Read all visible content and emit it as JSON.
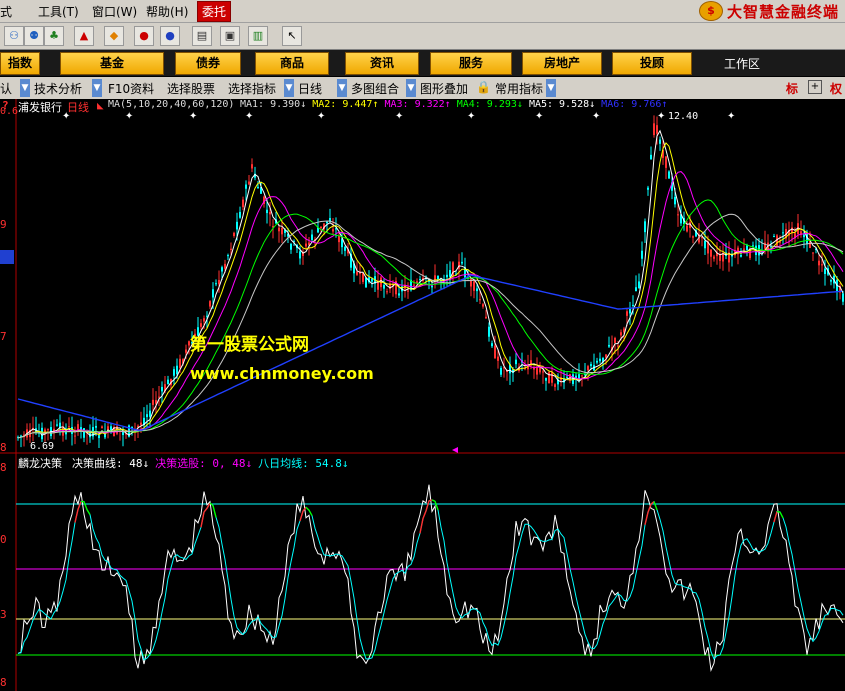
{
  "menu": {
    "items": [
      "式",
      "工具(T)",
      "窗口(W)",
      "帮助(H)",
      "委托"
    ],
    "brand": "大智慧金融终端"
  },
  "nav": {
    "buttons": [
      "指数",
      "基金",
      "债券",
      "商品",
      "资讯",
      "服务",
      "房地产",
      "投顾"
    ],
    "workspace": "工作区"
  },
  "subtoolbar": {
    "items": [
      "认",
      "技术分析",
      "F10资料",
      "选择股票",
      "选择指标",
      "日线",
      "多图组合",
      "图形叠加",
      "常用指标"
    ],
    "right": [
      "标",
      "权"
    ]
  },
  "price_panel": {
    "stock": "浦发银行",
    "period": "日线",
    "ma_params": "MA(5,10,20,40,60,120)",
    "ma": [
      {
        "label": "MA1:",
        "value": "9.390",
        "arrow": "↓",
        "color": "#ffffff"
      },
      {
        "label": "MA2:",
        "value": "9.447",
        "arrow": "↑",
        "color": "#ffff00"
      },
      {
        "label": "MA3:",
        "value": "9.322",
        "arrow": "↑",
        "color": "#ff00ff"
      },
      {
        "label": "MA4:",
        "value": "9.293",
        "arrow": "↓",
        "color": "#00ff00"
      },
      {
        "label": "MA5:",
        "value": "9.528",
        "arrow": "↓",
        "color": "#ffffff"
      },
      {
        "label": "MA6:",
        "value": "9.766",
        "arrow": "↑",
        "color": "#3030ff"
      }
    ],
    "y_ticks": [
      "0.6",
      "9",
      "7",
      "8"
    ],
    "high_label": "12.40",
    "low_label": "6.69",
    "watermark_title": "第一股票公式网",
    "watermark_url": "www.chnmoney.com"
  },
  "indicator_panel": {
    "name": "麟龙决策",
    "items": [
      {
        "label": "决策曲线:",
        "value": "48",
        "arrow": "↓",
        "color": "#ffffff"
      },
      {
        "label": "决策选股:",
        "value": "0, 48",
        "arrow": "↓",
        "color": "#ff00ff"
      },
      {
        "label": "八日均线:",
        "value": "54.8",
        "arrow": "↓",
        "color": "#00ffff"
      }
    ],
    "y_ticks": [
      "8",
      "0",
      "3",
      "8"
    ]
  },
  "colors": {
    "up": "#ff3030",
    "down": "#00ffff",
    "ma1": "#ffffff",
    "ma2": "#ffff00",
    "ma3": "#ff00ff",
    "ma4": "#00ff00",
    "ma5": "#e0e0e0",
    "ma6": "#2040ff",
    "watermark": "#ffff00"
  }
}
